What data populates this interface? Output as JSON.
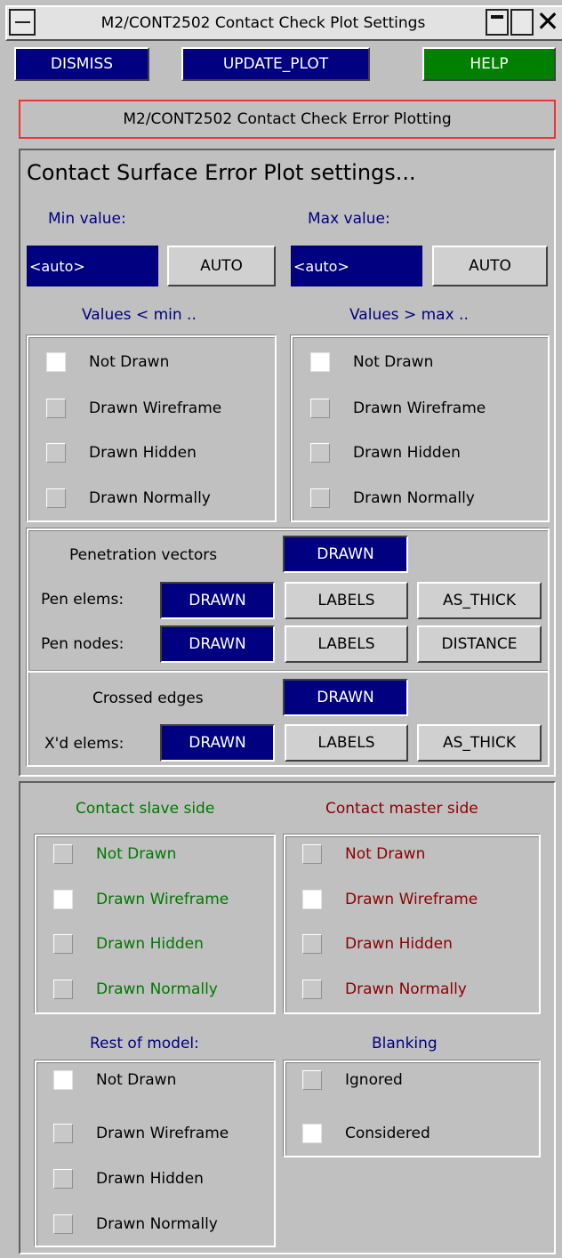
{
  "window": {
    "title": "M2/CONT2502 Contact Check Plot Settings"
  },
  "toolbar": {
    "dismiss": "DISMISS",
    "update_plot": "UPDATE_PLOT",
    "help": "HELP"
  },
  "header": "M2/CONT2502 Contact Check Error Plotting",
  "error_plot": {
    "heading": "Contact Surface Error Plot settings...",
    "min_label": "Min value:",
    "max_label": "Max value:",
    "min_value": "<auto>",
    "max_value": "<auto>",
    "auto": "AUTO",
    "below_label": "Values < min ..",
    "above_label": "Values > max ..",
    "below_options": [
      "Not Drawn",
      "Drawn Wireframe",
      "Drawn Hidden",
      "Drawn Normally"
    ],
    "above_options": [
      "Not Drawn",
      "Drawn Wireframe",
      "Drawn Hidden",
      "Drawn Normally"
    ],
    "below_selected": "Not Drawn",
    "above_selected": "Not Drawn"
  },
  "penetration": {
    "vectors_label": "Penetration vectors",
    "vectors_btn": "DRAWN",
    "elems_label": "Pen elems:",
    "elems_btn": "DRAWN",
    "elems_labels": "LABELS",
    "elems_thick": "AS_THICK",
    "nodes_label": "Pen nodes:",
    "nodes_btn": "DRAWN",
    "nodes_labels": "LABELS",
    "nodes_distance": "DISTANCE"
  },
  "crossed": {
    "edges_label": "Crossed edges",
    "edges_btn": "DRAWN",
    "elems_label": "X'd elems:",
    "elems_btn": "DRAWN",
    "elems_labels": "LABELS",
    "elems_thick": "AS_THICK"
  },
  "sides": {
    "slave_label": "Contact slave side",
    "master_label": "Contact master side",
    "slave_options": [
      "Not Drawn",
      "Drawn Wireframe",
      "Drawn Hidden",
      "Drawn Normally"
    ],
    "master_options": [
      "Not Drawn",
      "Drawn Wireframe",
      "Drawn Hidden",
      "Drawn Normally"
    ],
    "slave_selected": "Drawn Wireframe",
    "master_selected": "Drawn Wireframe",
    "slave_color": "#007800",
    "master_color": "#8b0000"
  },
  "rest": {
    "label": "Rest of model:",
    "options": [
      "Not Drawn",
      "Drawn Wireframe",
      "Drawn Hidden",
      "Drawn Normally"
    ],
    "selected": "Not Drawn"
  },
  "blanking": {
    "label": "Blanking",
    "options": [
      "Ignored",
      "Considered"
    ],
    "selected": "Considered"
  },
  "colors": {
    "navy": "#000080",
    "green": "#008000",
    "panel": "#c0c0c0"
  },
  "icons": {
    "menu": "menu-dash-icon",
    "minimize": "minimize-icon",
    "maximize": "maximize-icon",
    "close": "close-x-icon"
  }
}
